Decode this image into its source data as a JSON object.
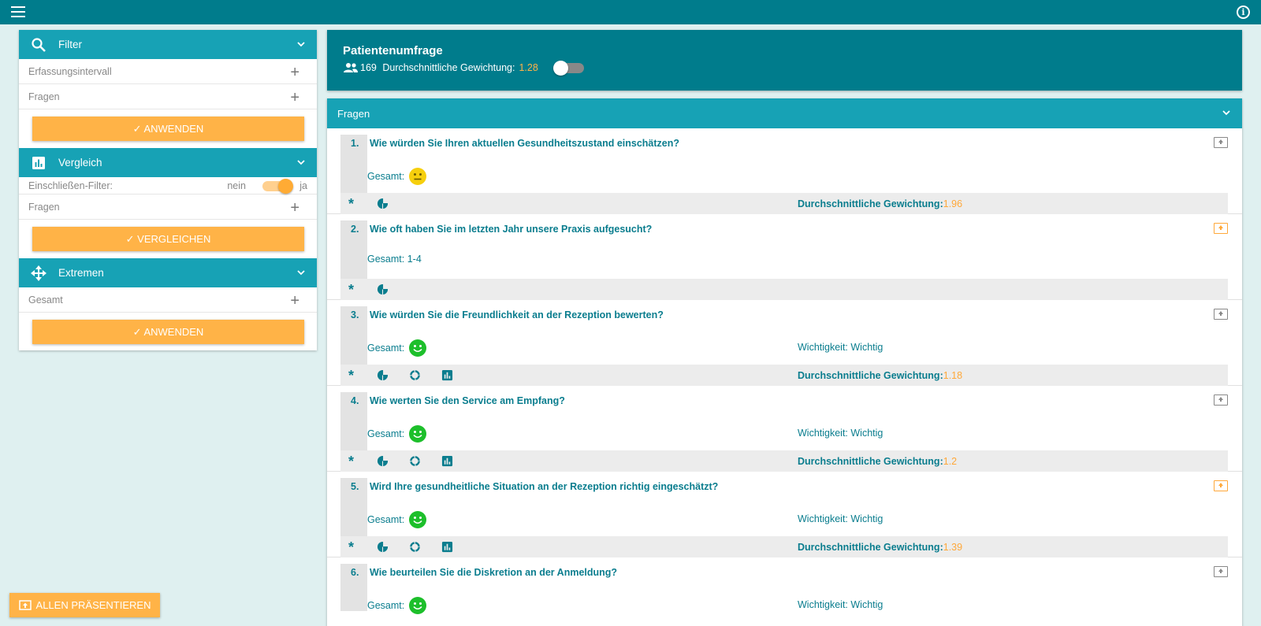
{
  "sidebar": {
    "filter": {
      "title": "Filter",
      "rows": [
        "Erfassungsintervall",
        "Fragen"
      ],
      "button": "ANWENDEN"
    },
    "vergleich": {
      "title": "Vergleich",
      "toggle_label": "Einschließen-Filter:",
      "toggle_off": "nein",
      "toggle_on": "ja",
      "rows": [
        "Fragen"
      ],
      "button": "VERGLEICHEN"
    },
    "extremen": {
      "title": "Extremen",
      "rows": [
        "Gesamt"
      ],
      "button": "ANWENDEN"
    }
  },
  "present_all": "ALLEN PRÄSENTIEREN",
  "header": {
    "title": "Patientenumfrage",
    "count": "169",
    "avg_label": "Durchschnittliche Gewichtung:",
    "avg_value": "1.28"
  },
  "questions_title": "Fragen",
  "labels": {
    "gesamt": "Gesamt:",
    "avg": "Durchschnittliche Gewichtung:",
    "star": "*"
  },
  "questions": [
    {
      "num": "1.",
      "text": "Wie würden Sie Ihren aktuellen Gesundheitszustand einschätzen?",
      "gesamt": "",
      "mood": "neutral",
      "wichtigkeit": "",
      "avg": "1.96",
      "present_active": false
    },
    {
      "num": "2.",
      "text": "Wie oft haben Sie im letzten Jahr unsere Praxis aufgesucht?",
      "gesamt": "Gesamt: 1-4",
      "mood": "",
      "wichtigkeit": "",
      "avg": "",
      "present_active": true
    },
    {
      "num": "3.",
      "text": "Wie würden Sie die Freundlichkeit an der Rezeption bewerten?",
      "gesamt": "",
      "mood": "happy",
      "wichtigkeit": "Wichtigkeit: Wichtig",
      "avg": "1.18",
      "present_active": false
    },
    {
      "num": "4.",
      "text": "Wie werten Sie den Service am Empfang?",
      "gesamt": "",
      "mood": "happy",
      "wichtigkeit": "Wichtigkeit: Wichtig",
      "avg": "1.2",
      "present_active": false
    },
    {
      "num": "5.",
      "text": "Wird Ihre gesundheitliche Situation an der Rezeption richtig eingeschätzt?",
      "gesamt": "",
      "mood": "happy",
      "wichtigkeit": "Wichtigkeit: Wichtig",
      "avg": "1.39",
      "present_active": true
    },
    {
      "num": "6.",
      "text": "Wie beurteilen Sie die Diskretion an der Anmeldung?",
      "gesamt": "",
      "mood": "happy",
      "wichtigkeit": "Wichtigkeit: Wichtig",
      "avg": "",
      "present_active": false
    }
  ],
  "colors": {
    "topbar": "#007c8c",
    "section_head": "#17a2b5",
    "accent_orange": "#ffb347",
    "text_teal": "#0a7d8e",
    "smiley_happy": "#1dbf2b",
    "smiley_neutral": "#f6cf0d"
  }
}
